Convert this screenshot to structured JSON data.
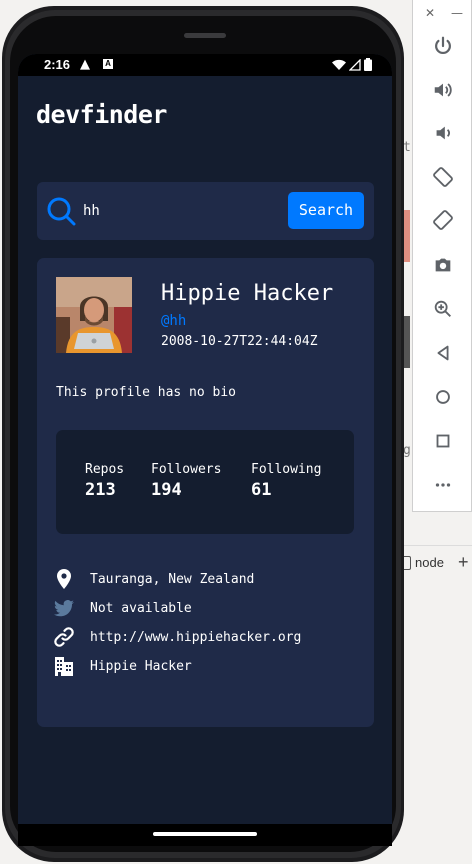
{
  "statusbar": {
    "time": "2:16"
  },
  "app": {
    "title": "devfinder"
  },
  "search": {
    "value": "hh",
    "button_label": "Search"
  },
  "profile": {
    "name": "Hippie Hacker",
    "login": "@hh",
    "joined": "2008-10-27T22:44:04Z",
    "bio": "This profile has no bio"
  },
  "stats": [
    {
      "label": "Repos",
      "value": "213"
    },
    {
      "label": "Followers",
      "value": "194"
    },
    {
      "label": "Following",
      "value": "61"
    }
  ],
  "info": {
    "location": "Tauranga, New Zealand",
    "twitter": "Not available",
    "website": "http://www.hippiehacker.org",
    "company": "Hippie Hacker"
  },
  "ide": {
    "tab_label": "node"
  },
  "colors": {
    "accent": "#0079ff",
    "background": "#141d2f",
    "card": "#1f2a48"
  }
}
